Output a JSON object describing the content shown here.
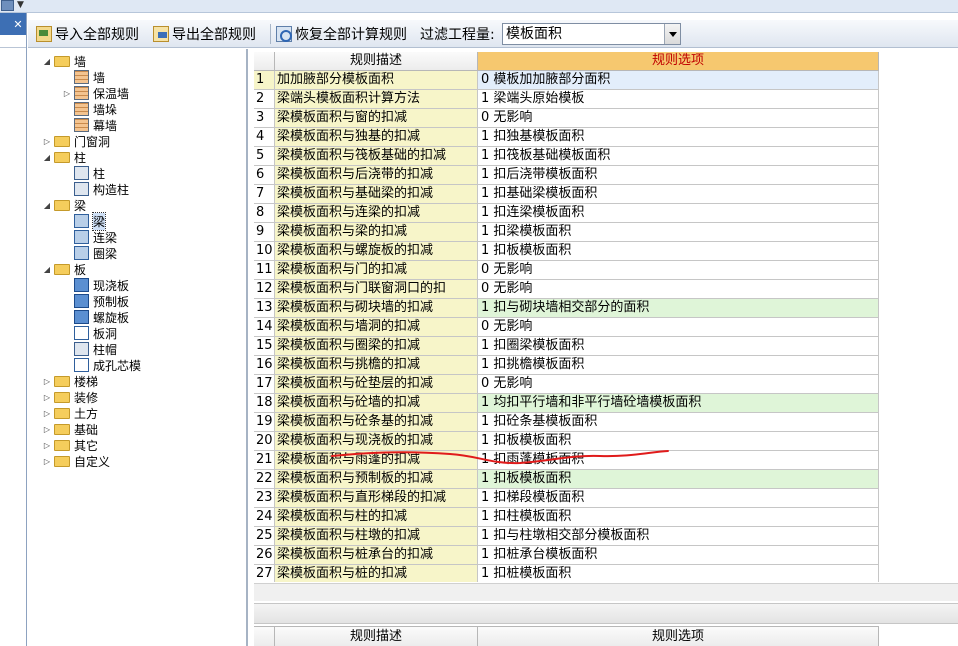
{
  "toolbar": {
    "import_label": "导入全部规则",
    "export_label": "导出全部规则",
    "restore_label": "恢复全部计算规则",
    "filter_label": "过滤工程量:",
    "filter_value": "模板面积"
  },
  "tree": [
    {
      "label": "墙",
      "level": 0,
      "kind": "folder",
      "expander": "open"
    },
    {
      "label": "墙",
      "level": 1,
      "kind": "wall"
    },
    {
      "label": "保温墙",
      "level": 1,
      "kind": "wall",
      "expander": "closed"
    },
    {
      "label": "墙垛",
      "level": 1,
      "kind": "wall"
    },
    {
      "label": "幕墙",
      "level": 1,
      "kind": "wall"
    },
    {
      "label": "门窗洞",
      "level": 0,
      "kind": "folder",
      "expander": "closed"
    },
    {
      "label": "柱",
      "level": 0,
      "kind": "folder",
      "expander": "open"
    },
    {
      "label": "柱",
      "level": 1,
      "kind": "col"
    },
    {
      "label": "构造柱",
      "level": 1,
      "kind": "col"
    },
    {
      "label": "梁",
      "level": 0,
      "kind": "folder",
      "expander": "open"
    },
    {
      "label": "梁",
      "level": 1,
      "kind": "beam",
      "selected": true
    },
    {
      "label": "连梁",
      "level": 1,
      "kind": "beam"
    },
    {
      "label": "圈梁",
      "level": 1,
      "kind": "beam"
    },
    {
      "label": "板",
      "level": 0,
      "kind": "folder",
      "expander": "open"
    },
    {
      "label": "现浇板",
      "level": 1,
      "kind": "slab"
    },
    {
      "label": "预制板",
      "level": 1,
      "kind": "slab"
    },
    {
      "label": "螺旋板",
      "level": 1,
      "kind": "slab"
    },
    {
      "label": "板洞",
      "level": 1,
      "kind": "hole"
    },
    {
      "label": "柱帽",
      "level": 1,
      "kind": "col"
    },
    {
      "label": "成孔芯模",
      "level": 1,
      "kind": "hole"
    },
    {
      "label": "楼梯",
      "level": 0,
      "kind": "folder",
      "expander": "closed"
    },
    {
      "label": "装修",
      "level": 0,
      "kind": "folder",
      "expander": "closed"
    },
    {
      "label": "土方",
      "level": 0,
      "kind": "folder",
      "expander": "closed"
    },
    {
      "label": "基础",
      "level": 0,
      "kind": "folder",
      "expander": "closed"
    },
    {
      "label": "其它",
      "level": 0,
      "kind": "folder",
      "expander": "closed"
    },
    {
      "label": "自定义",
      "level": 0,
      "kind": "folder",
      "expander": "closed"
    }
  ],
  "grid": {
    "col_desc": "规则描述",
    "col_opt": "规则选项",
    "rows": [
      {
        "n": "1",
        "desc": "加加腋部分模板面积",
        "opt": "0  模板加加腋部分面积",
        "style": "first"
      },
      {
        "n": "2",
        "desc": "梁端头模板面积计算方法",
        "opt": "1  梁端头原始模板"
      },
      {
        "n": "3",
        "desc": "梁模板面积与窗的扣减",
        "opt": "0    无影响"
      },
      {
        "n": "4",
        "desc": "梁模板面积与独基的扣减",
        "opt": "1  扣独基模板面积"
      },
      {
        "n": "5",
        "desc": "梁模板面积与筏板基础的扣减",
        "opt": "1  扣筏板基础模板面积"
      },
      {
        "n": "6",
        "desc": "梁模板面积与后浇带的扣减",
        "opt": "1  扣后浇带模板面积"
      },
      {
        "n": "7",
        "desc": "梁模板面积与基础梁的扣减",
        "opt": "1  扣基础梁模板面积"
      },
      {
        "n": "8",
        "desc": "梁模板面积与连梁的扣减",
        "opt": "1  扣连梁模板面积"
      },
      {
        "n": "9",
        "desc": "梁模板面积与梁的扣减",
        "opt": "1  扣梁模板面积"
      },
      {
        "n": "10",
        "desc": "梁模板面积与螺旋板的扣减",
        "opt": "1  扣板模板面积"
      },
      {
        "n": "11",
        "desc": "梁模板面积与门的扣减",
        "opt": "0    无影响"
      },
      {
        "n": "12",
        "desc": "梁模板面积与门联窗洞口的扣",
        "opt": "0    无影响"
      },
      {
        "n": "13",
        "desc": "梁模板面积与砌块墙的扣减",
        "opt": "1  扣与砌块墙相交部分的面积",
        "style": "green"
      },
      {
        "n": "14",
        "desc": "梁模板面积与墙洞的扣减",
        "opt": "0    无影响"
      },
      {
        "n": "15",
        "desc": "梁模板面积与圈梁的扣减",
        "opt": "1  扣圈梁模板面积"
      },
      {
        "n": "16",
        "desc": "梁模板面积与挑檐的扣减",
        "opt": "1  扣挑檐模板面积"
      },
      {
        "n": "17",
        "desc": "梁模板面积与砼垫层的扣减",
        "opt": "0    无影响"
      },
      {
        "n": "18",
        "desc": "梁模板面积与砼墙的扣减",
        "opt": "1  均扣平行墙和非平行墙砼墙模板面积",
        "style": "green"
      },
      {
        "n": "19",
        "desc": "梁模板面积与砼条基的扣减",
        "opt": "1  扣砼条基模板面积"
      },
      {
        "n": "20",
        "desc": "梁模板面积与现浇板的扣减",
        "opt": "1  扣板模板面积"
      },
      {
        "n": "21",
        "desc": "梁模板面积与雨蓬的扣减",
        "opt": "1  扣雨蓬模板面积"
      },
      {
        "n": "22",
        "desc": "梁模板面积与预制板的扣减",
        "opt": "1  扣板模板面积",
        "style": "green"
      },
      {
        "n": "23",
        "desc": "梁模板面积与直形梯段的扣减",
        "opt": "1  扣梯段模板面积"
      },
      {
        "n": "24",
        "desc": "梁模板面积与柱的扣减",
        "opt": "1  扣柱模板面积"
      },
      {
        "n": "25",
        "desc": "梁模板面积与柱墩的扣减",
        "opt": "1  扣与柱墩相交部分模板面积"
      },
      {
        "n": "26",
        "desc": "梁模板面积与桩承台的扣减",
        "opt": "1  扣桩承台模板面积"
      },
      {
        "n": "27",
        "desc": "梁模板面积与桩的扣减",
        "opt": "1  扣桩模板面积"
      }
    ]
  },
  "bottom_grid": {
    "col_desc": "规则描述",
    "col_opt": "规则选项"
  },
  "colors": {
    "header_highlight": "#f6c86f",
    "desc_cell": "#f7f5c9",
    "green_row": "#dff5d8",
    "selected_row": "#e3eefb",
    "annotation": "#e01b1b"
  }
}
